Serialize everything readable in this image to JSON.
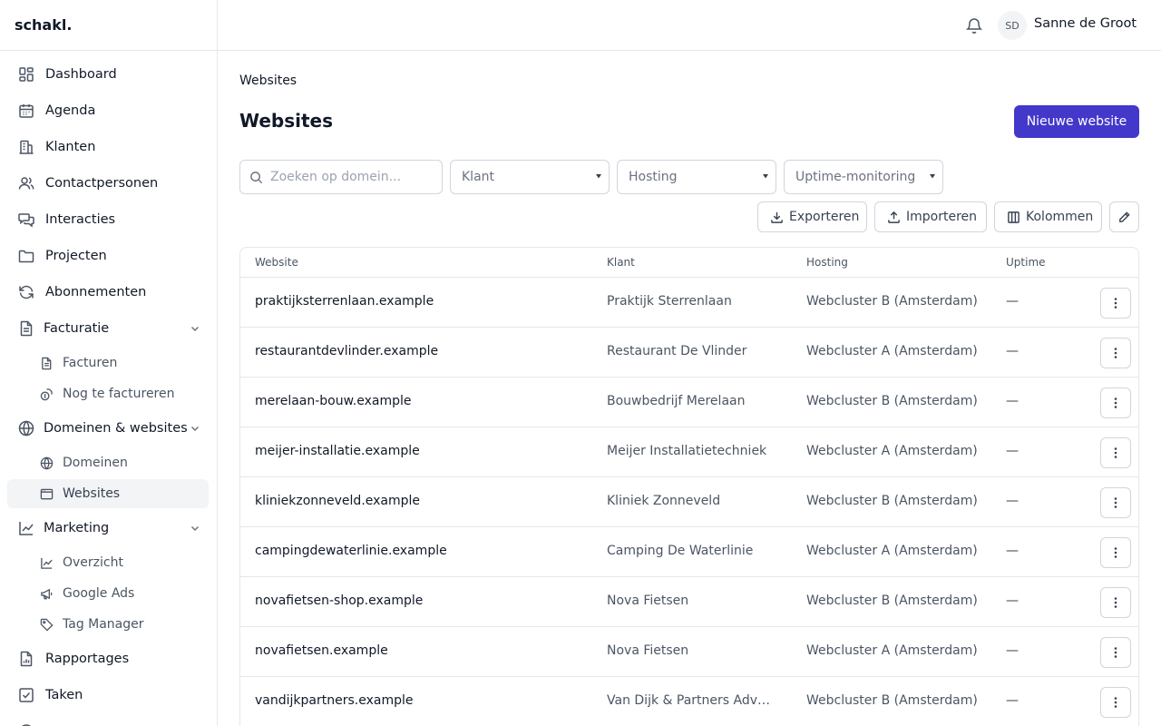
{
  "app": {
    "logo": "schakl."
  },
  "sidebar": {
    "items": [
      {
        "label": "Dashboard",
        "icon": "dashboard-icon"
      },
      {
        "label": "Agenda",
        "icon": "calendar-icon"
      },
      {
        "label": "Klanten",
        "icon": "building-icon"
      },
      {
        "label": "Contactpersonen",
        "icon": "users-icon"
      },
      {
        "label": "Interacties",
        "icon": "chat-icon"
      },
      {
        "label": "Projecten",
        "icon": "folder-icon"
      },
      {
        "label": "Abonnementen",
        "icon": "refresh-icon"
      }
    ],
    "facturatie": {
      "label": "Facturatie",
      "subitems": [
        "Facturen",
        "Nog te factureren"
      ]
    },
    "domeinen": {
      "label": "Domeinen & websites",
      "subitems": [
        "Domeinen",
        "Websites"
      ]
    },
    "marketing": {
      "label": "Marketing",
      "subitems": [
        "Overzicht",
        "Google Ads",
        "Tag Manager"
      ]
    },
    "bottom_items": [
      {
        "label": "Rapportages",
        "icon": "report-icon"
      },
      {
        "label": "Taken",
        "icon": "checkbox-icon"
      }
    ],
    "active": "Websites"
  },
  "topbar": {
    "user_initials": "SD",
    "user_name": "Sanne de Groot"
  },
  "page": {
    "breadcrumb": "Websites",
    "title": "Websites",
    "new_button": "Nieuwe website"
  },
  "filters": {
    "search_placeholder": "Zoeken op domein...",
    "klant": "Klant",
    "hosting": "Hosting",
    "uptime": "Uptime-monitoring"
  },
  "toolbar": {
    "export": "Exporteren",
    "import": "Importeren",
    "columns": "Kolommen"
  },
  "table": {
    "headers": [
      "Website",
      "Klant",
      "Hosting",
      "Uptime"
    ],
    "rows": [
      {
        "website": "praktijksterrenlaan.example",
        "klant": "Praktijk Sterrenlaan",
        "hosting": "Webcluster B (Amsterdam)",
        "uptime": "—"
      },
      {
        "website": "restaurantdevlinder.example",
        "klant": "Restaurant De Vlinder",
        "hosting": "Webcluster A (Amsterdam)",
        "uptime": "—"
      },
      {
        "website": "merelaan-bouw.example",
        "klant": "Bouwbedrijf Merelaan",
        "hosting": "Webcluster B (Amsterdam)",
        "uptime": "—"
      },
      {
        "website": "meijer-installatie.example",
        "klant": "Meijer Installatietechniek",
        "hosting": "Webcluster A (Amsterdam)",
        "uptime": "—"
      },
      {
        "website": "kliniekzonneveld.example",
        "klant": "Kliniek Zonneveld",
        "hosting": "Webcluster B (Amsterdam)",
        "uptime": "—"
      },
      {
        "website": "campingdewaterlinie.example",
        "klant": "Camping De Waterlinie",
        "hosting": "Webcluster A (Amsterdam)",
        "uptime": "—"
      },
      {
        "website": "novafietsen-shop.example",
        "klant": "Nova Fietsen",
        "hosting": "Webcluster B (Amsterdam)",
        "uptime": "—"
      },
      {
        "website": "novafietsen.example",
        "klant": "Nova Fietsen",
        "hosting": "Webcluster A (Amsterdam)",
        "uptime": "—"
      },
      {
        "website": "vandijkpartners.example",
        "klant": "Van Dijk & Partners Advoc...",
        "hosting": "Webcluster B (Amsterdam)",
        "uptime": "—"
      }
    ]
  },
  "colors": {
    "primary": "#4338ca",
    "border": "#e5e7eb",
    "active_bg": "#f3f4f6"
  }
}
